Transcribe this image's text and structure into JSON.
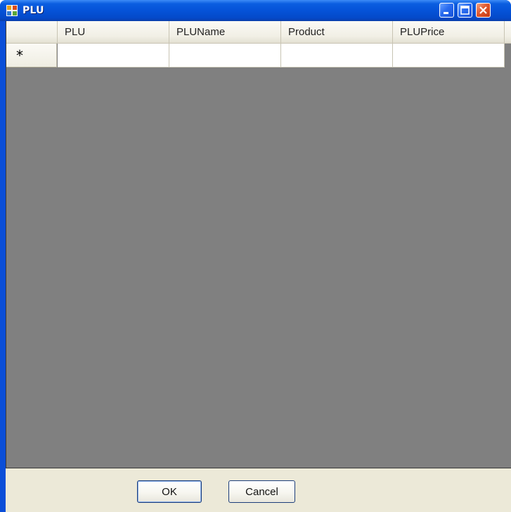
{
  "window": {
    "title": "PLU",
    "icon": "app-icon",
    "controls": [
      "minimize-icon",
      "maximize-icon",
      "close-icon"
    ]
  },
  "grid": {
    "columns": [
      "PLU",
      "PLUName",
      "Product",
      "PLUPrice"
    ],
    "new_row_marker": "*",
    "rows": []
  },
  "buttons": {
    "ok_label": "OK",
    "cancel_label": "Cancel"
  },
  "colors": {
    "titlebar": "#0553d8",
    "grid_background": "#808080",
    "client_background": "#ece9d8",
    "close_button": "#e0582d"
  }
}
